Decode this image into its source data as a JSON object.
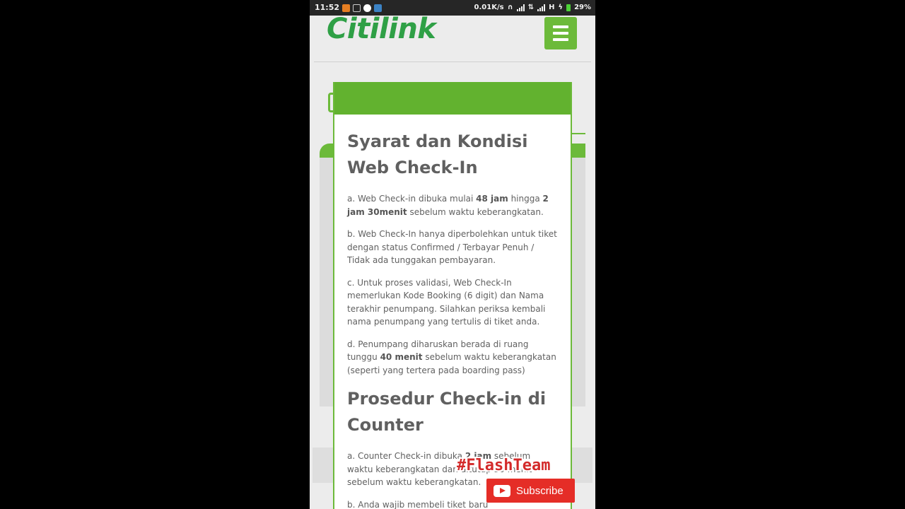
{
  "status_bar": {
    "time": "11:52",
    "speed": "0.01K/s",
    "network": "H",
    "battery": "29%"
  },
  "header": {
    "logo_text": "Citilink",
    "menu_icon": "hamburger-icon"
  },
  "colors": {
    "brand_green": "#62b22f",
    "logo_green": "#2fa046",
    "subscribe_red": "#e52d27"
  },
  "modal": {
    "section1": {
      "title": "Syarat dan Kondisi Web Check-In",
      "items": [
        {
          "pre": "a. Web Check-in dibuka mulai ",
          "b1": "48 jam",
          "mid": " hingga ",
          "b2": "2 jam 30menit",
          "post": " sebelum waktu keberangkatan."
        },
        {
          "text": "b. Web Check-In hanya diperbolehkan untuk tiket dengan status Confirmed / Terbayar Penuh / Tidak ada tunggakan pembayaran."
        },
        {
          "text": "c. Untuk proses validasi, Web Check-In memerlukan Kode Booking (6 digit) dan Nama terakhir penumpang. Silahkan periksa kembali nama penumpang yang tertulis di tiket anda."
        },
        {
          "pre": "d. Penumpang diharuskan berada di ruang tunggu ",
          "b1": "40 menit",
          "post": " sebelum waktu keberangkatan (seperti yang tertera pada boarding pass)"
        }
      ]
    },
    "section2": {
      "title": "Prosedur Check-in di Counter",
      "items": [
        {
          "pre": "a. Counter Check-in dibuka ",
          "b1": "2 jam",
          "post": " sebelum waktu keberangkatan dan ditutup 30 menit sebelum waktu keberangkatan."
        },
        {
          "text": "b. Anda wajib membeli tiket baru"
        }
      ]
    }
  },
  "overlay": {
    "watermark": "#FlashTeam",
    "subscribe_label": "Subscribe"
  }
}
